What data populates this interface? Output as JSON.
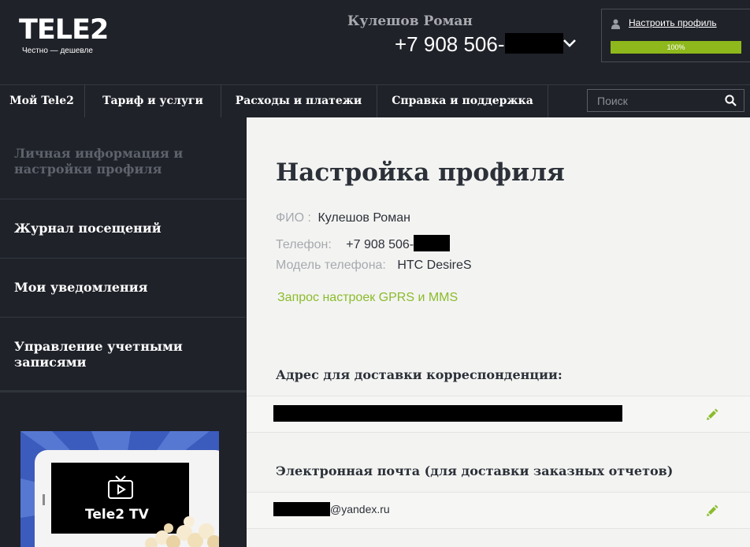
{
  "brand": {
    "logo_text": "TELE2",
    "slogan": "Честно — дешевле"
  },
  "user": {
    "name": "Кулешов Роман",
    "phone_prefix": "+7 908 506-"
  },
  "profile_box": {
    "link_label": "Настроить профиль",
    "progress_text": "100%",
    "progress_value": 1.0
  },
  "nav": {
    "items": [
      {
        "label": "Мой Tele2"
      },
      {
        "label": "Тариф и услуги"
      },
      {
        "label": "Расходы и платежи"
      },
      {
        "label": "Справка и поддержка"
      }
    ],
    "search_placeholder": "Поиск"
  },
  "sidebar": {
    "items": [
      {
        "label": "Личная информация и настройки профиля"
      },
      {
        "label": "Журнал посещений"
      },
      {
        "label": "Мои уведомления"
      },
      {
        "label": "Управление учетными записями"
      }
    ],
    "promo_title": "Tele2 TV"
  },
  "main": {
    "title": "Настройка профиля",
    "fio_label": "ФИО :",
    "fio_value": "Кулешов Роман",
    "phone_label": "Телефон:",
    "phone_value": "+7 908 506-",
    "model_label": "Модель телефона:",
    "model_value": "HTC DesireS",
    "gprs_link": "Запрос настроек GPRS и MMS",
    "address_title": "Адрес для доставки корреспонденции:",
    "email_title": "Электронная почта (для доставки заказных отчетов)",
    "email_domain": "@yandex.ru"
  },
  "colors": {
    "header_bg": "#1f2229",
    "accent_green": "#8fb81c",
    "link_green": "#8cbb2c",
    "main_bg": "#f3f4f2",
    "promo_blue": "#3d5fc0"
  }
}
